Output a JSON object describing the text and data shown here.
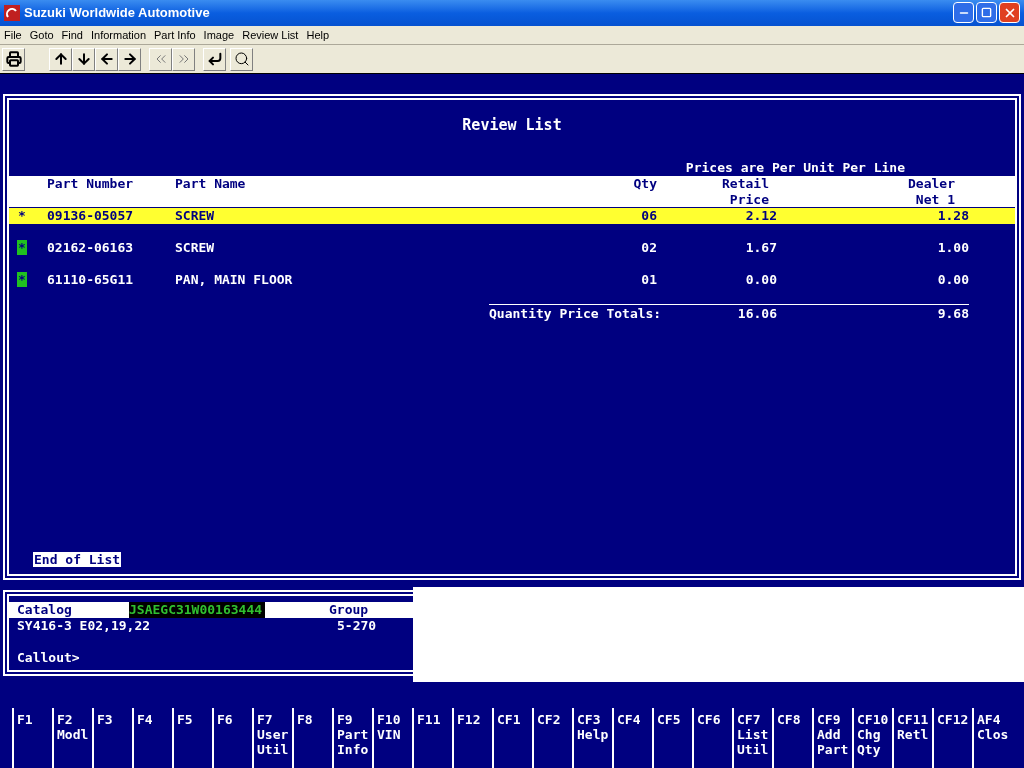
{
  "window": {
    "title": "Suzuki Worldwide Automotive"
  },
  "menu": [
    "File",
    "Goto",
    "Find",
    "Information",
    "Part Info",
    "Image",
    "Review List",
    "Help"
  ],
  "toolbar": [
    {
      "kind": "print"
    },
    {
      "kind": "up"
    },
    {
      "kind": "down"
    },
    {
      "kind": "left"
    },
    {
      "kind": "right"
    },
    {
      "kind": "prev"
    },
    {
      "kind": "next"
    },
    {
      "kind": "enter"
    },
    {
      "kind": "search"
    }
  ],
  "review": {
    "title": "Review List",
    "note": "Prices are Per Unit Per Line",
    "columns": [
      [
        "Part Number"
      ],
      [
        "Part Name"
      ],
      [
        "Qty"
      ],
      [
        "Retail",
        "Price"
      ],
      [
        "Dealer",
        "Net 1"
      ]
    ],
    "rows": [
      {
        "marker": "*",
        "part_number": "09136-05057",
        "part_name": "SCREW",
        "qty": "06",
        "retail": "2.12",
        "dealer": "1.28",
        "selected": true
      },
      {
        "marker": "*",
        "part_number": "02162-06163",
        "part_name": "SCREW",
        "qty": "02",
        "retail": "1.67",
        "dealer": "1.00",
        "selected": false
      },
      {
        "marker": "*",
        "part_number": "61110-65G11",
        "part_name": "PAN, MAIN FLOOR",
        "qty": "01",
        "retail": "0.00",
        "dealer": "0.00",
        "selected": false
      }
    ],
    "totals": {
      "label": "Quantity Price Totals:",
      "retail": "16.06",
      "dealer": "9.68"
    },
    "end": "End of List"
  },
  "info": {
    "catalog_label": "Catalog",
    "vin": "JSAEGC31W00163444",
    "group_label": "Group",
    "catalog": "SY416-3 E02,19,22",
    "group": "5-270",
    "callout": "Callout>"
  },
  "function_keys": [
    {
      "key": "F1"
    },
    {
      "key": "F2",
      "label": [
        "Modl"
      ]
    },
    {
      "key": "F3"
    },
    {
      "key": "F4"
    },
    {
      "key": "F5"
    },
    {
      "key": "F6"
    },
    {
      "key": "F7",
      "label": [
        "User",
        "Util"
      ]
    },
    {
      "key": "F8"
    },
    {
      "key": "F9",
      "label": [
        "Part",
        "Info"
      ]
    },
    {
      "key": "F10",
      "label": [
        "VIN"
      ]
    },
    {
      "key": "F11"
    },
    {
      "key": "F12"
    },
    {
      "key": "CF1"
    },
    {
      "key": "CF2"
    },
    {
      "key": "CF3",
      "label": [
        "Help"
      ]
    },
    {
      "key": "CF4"
    },
    {
      "key": "CF5"
    },
    {
      "key": "CF6"
    },
    {
      "key": "CF7",
      "label": [
        "List",
        "Util"
      ]
    },
    {
      "key": "CF8"
    },
    {
      "key": "CF9",
      "label": [
        "Add",
        "Part"
      ]
    },
    {
      "key": "CF10",
      "label": [
        "Chg",
        "Qty"
      ]
    },
    {
      "key": "CF11",
      "label": [
        "Retl"
      ]
    },
    {
      "key": "CF12"
    },
    {
      "key": "AF4",
      "label": [
        "Clos"
      ]
    }
  ]
}
